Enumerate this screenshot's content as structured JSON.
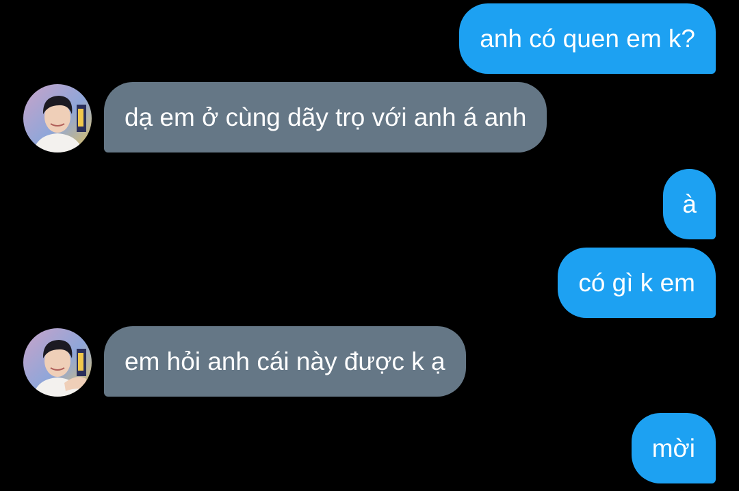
{
  "conversation": {
    "messages": [
      {
        "direction": "outgoing",
        "text": "anh có quen em k?"
      },
      {
        "direction": "incoming",
        "text": "dạ em ở cùng dãy trọ với anh á anh",
        "avatar": "contact-avatar"
      },
      {
        "direction": "outgoing",
        "text": "à"
      },
      {
        "direction": "outgoing",
        "text": "có gì k em"
      },
      {
        "direction": "incoming",
        "text": "em hỏi anh cái này được k ạ",
        "avatar": "contact-avatar"
      },
      {
        "direction": "outgoing",
        "text": "mời"
      }
    ]
  },
  "colors": {
    "background": "#000000",
    "outgoing_bubble": "#1da1f2",
    "incoming_bubble": "#657786",
    "text": "#ffffff"
  }
}
